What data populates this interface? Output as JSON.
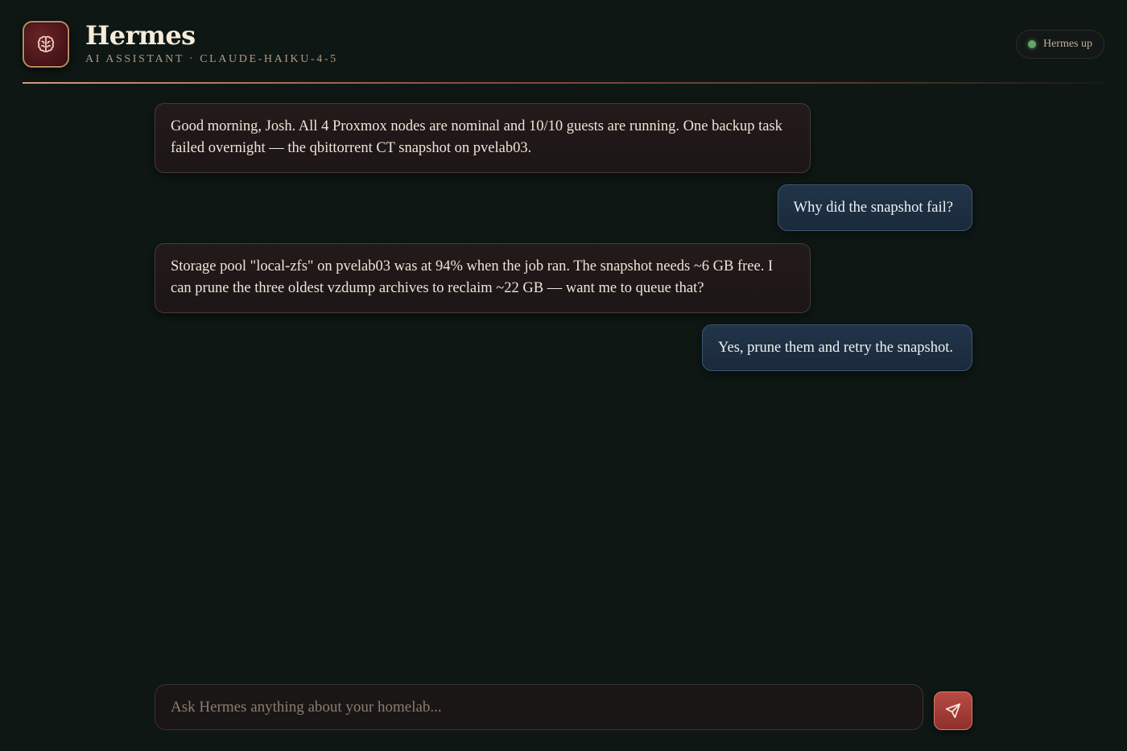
{
  "header": {
    "title": "Hermes",
    "subtitle": "AI ASSISTANT · CLAUDE-HAIKU-4-5",
    "logo_icon": "brain-icon",
    "status": {
      "label": "Hermes up",
      "color": "#63a567"
    }
  },
  "messages": [
    {
      "role": "assistant",
      "text": "Good morning, Josh. All 4 Proxmox nodes are nominal and 10/10 guests are running. One backup task failed overnight — the qbittorrent CT snapshot on pvelab03."
    },
    {
      "role": "user",
      "text": "Why did the snapshot fail?"
    },
    {
      "role": "assistant",
      "text": "Storage pool \"local-zfs\" on pvelab03 was at 94% when the job ran. The snapshot needs ~6 GB free. I can prune the three oldest vzdump archives to reclaim ~22 GB — want me to queue that?"
    },
    {
      "role": "user",
      "text": "Yes, prune them and retry the snapshot."
    }
  ],
  "composer": {
    "placeholder": "Ask Hermes anything about your homelab...",
    "value": "",
    "send_icon": "send-icon"
  },
  "colors": {
    "background": "#0e1714",
    "accent": "#b94a44",
    "user_bubble": "#213449",
    "assistant_bubble": "#231a1a"
  }
}
